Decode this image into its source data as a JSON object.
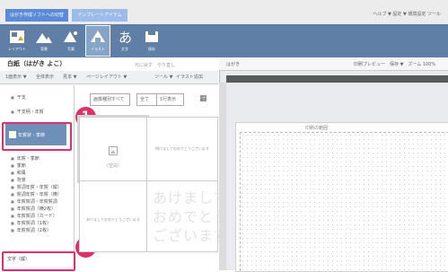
{
  "tabs": [
    {
      "label": "はがき作成ソフトへの切替"
    },
    {
      "label": "テンプレートアイテム"
    }
  ],
  "header_menu": "ヘルプ ▼ 設定 ▼ 環境設定 ツール",
  "toolbar": {
    "items": [
      {
        "label": "レイアウト",
        "icon": "layout-icon"
      },
      {
        "label": "背景",
        "icon": "landscape-icon"
      },
      {
        "label": "写真",
        "icon": "photo-icon"
      },
      {
        "label": "イラスト",
        "icon": "illustration-icon"
      },
      {
        "label": "文字",
        "icon": "text-icon"
      },
      {
        "label": "保存",
        "icon": "save-icon"
      }
    ]
  },
  "left": {
    "title": "白紙（はがき よこ）",
    "actions": "元に戻す　やり直し",
    "bar": [
      "1面表示 ▼",
      "全体表示",
      "見本 ▼",
      "ページレイアウト ▼",
      "ツール ▼",
      "イラスト追加"
    ],
    "filter": {
      "dropdown1": "画像種別すべて",
      "dropdown2": "全て",
      "dropdown3": "1行表示"
    },
    "categories": [
      {
        "label": "干支"
      },
      {
        "label": "干支柄・年賀"
      },
      {
        "label": "年賀・季節"
      },
      {
        "label": "季節"
      },
      {
        "label": "和風"
      },
      {
        "label": "背景"
      },
      {
        "label": "賀詞年賀・年賀（縦）"
      },
      {
        "label": "賀詞年賀・年賀（横）"
      },
      {
        "label": "年賀賀詞・年賀賀詞"
      },
      {
        "label": "年賀賀詞（横2枚）"
      },
      {
        "label": "年賀賀詞（カード）"
      },
      {
        "label": "年賀賀詞（1枚）"
      },
      {
        "label": "年賀賀詞（2枚）"
      }
    ],
    "selected_item": "年賀状・季節",
    "bottom_item": "文字（縦）",
    "cells": {
      "a": "（空白）",
      "b": "明けましておめでとうございます",
      "c": "あけましておめでとうございます",
      "calligraphy": "あけまして\nおめでとう\nございます"
    }
  },
  "right": {
    "sheet_label": "はがき",
    "head_controls": "印刷プレビュー　保存 ▼　ズーム 100%",
    "page_label": "印刷の範囲"
  },
  "callouts": [
    "1",
    "2"
  ],
  "colors": {
    "accent": "#e0306a",
    "toolbar": "#5f7fa6",
    "tab": "#5b8bd6"
  }
}
